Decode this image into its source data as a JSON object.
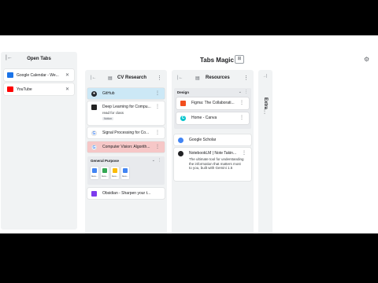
{
  "sidebar": {
    "title": "Open Tabs",
    "collapse_icon": "collapse-left-icon",
    "tabs": [
      {
        "title": "Google Calendar - We...",
        "favicon_color": "#1a73e8",
        "close": "✕"
      },
      {
        "title": "YouTube",
        "favicon_color": "#ff0000",
        "close": "✕"
      }
    ]
  },
  "header": {
    "title": "Tabs Magic",
    "add_icon": "add-collection-icon",
    "settings_icon": "gear-icon"
  },
  "collections": [
    {
      "name": "CV Research",
      "cards": [
        {
          "title": "GitHub",
          "highlight": "#cce8f6"
        },
        {
          "title": "Deep Learning for Compu...",
          "note": "read for class",
          "tag": "Notion"
        },
        {
          "title": "Signal Processing for Co..."
        },
        {
          "title": "Computer Vision: Algorith...",
          "highlight": "#f6c7c7"
        }
      ],
      "group": {
        "title": "General Purpose",
        "items": [
          {
            "label": "Goo...",
            "color": "#4285f4"
          },
          {
            "label": "Goo...",
            "color": "#34a853"
          },
          {
            "label": "Goo...",
            "color": "#fbbc04"
          },
          {
            "label": "Goo...",
            "color": "#4285f4"
          }
        ]
      },
      "last_card": {
        "title": "Obsidian - Sharpen your t..."
      }
    },
    {
      "name": "Resources",
      "group": {
        "title": "Design",
        "cards": [
          {
            "title": "Figma: The Collaborati..."
          },
          {
            "title": "Home - Canva"
          }
        ]
      },
      "cards": [
        {
          "title": "Google Scholar"
        },
        {
          "title": "NotebookLM | Note Takin...",
          "desc": "The ultimate tool for understanding the information that matters most to you, built with Gemini 1.5"
        }
      ]
    }
  ],
  "extra": {
    "name": "Extra"
  },
  "icons": {
    "dots": "⋮",
    "chevron": "⌄",
    "collapse": "|←"
  }
}
